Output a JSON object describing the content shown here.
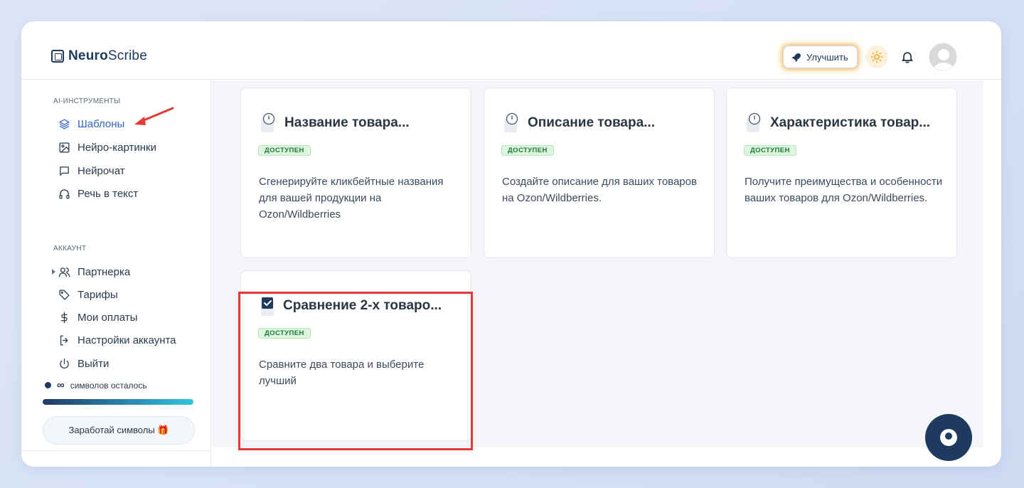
{
  "header": {
    "logo_bold": "Neuro",
    "logo_regular": "Scribe",
    "upgrade_label": "Улучшить"
  },
  "sidebar": {
    "tools_title": "AI-ИНСТРУМЕНТЫ",
    "tools": [
      {
        "label": "Шаблоны",
        "icon": "layers-icon",
        "active": true
      },
      {
        "label": "Нейро-картинки",
        "icon": "image-icon"
      },
      {
        "label": "Нейрочат",
        "icon": "chat-icon"
      },
      {
        "label": "Речь в текст",
        "icon": "headphones-icon"
      }
    ],
    "account_title": "АККАУНТ",
    "account": [
      {
        "label": "Партнерка",
        "icon": "users-icon"
      },
      {
        "label": "Тарифы",
        "icon": "tag-icon"
      },
      {
        "label": "Мои оплаты",
        "icon": "dollar-icon"
      },
      {
        "label": "Настройки аккаунта",
        "icon": "logout-arrow-icon"
      },
      {
        "label": "Выйти",
        "icon": "power-icon"
      }
    ],
    "credits_symbol": "∞",
    "credits_label": "символов осталось",
    "earn_label": "Заработай символы 🎁"
  },
  "cards": [
    {
      "title": "Название товара...",
      "badge": "ДОСТУПЕН",
      "desc": "Сгенерируйте кликбейтные названия для вашей продукции на Ozon/Wildberries",
      "icon": "clipboard-clock-icon"
    },
    {
      "title": "Описание товара...",
      "badge": "ДОСТУПЕН",
      "desc": "Создайте описание для ваших товаров на Ozon/Wildberries.",
      "icon": "clipboard-clock-icon"
    },
    {
      "title": "Характеристика товар...",
      "badge": "ДОСТУПЕН",
      "desc": "Получите преимущества и особенности ваших товаров для Ozon/Wildberries.",
      "icon": "clipboard-clock-icon"
    },
    {
      "title": "Сравнение 2-х товаро...",
      "badge": "ДОСТУПЕН",
      "desc": "Сравните два товара и выберите лучший",
      "icon": "checkbox-icon"
    }
  ],
  "colors": {
    "accent": "#2e63c7",
    "brand_dark": "#1e3a5f",
    "badge_green": "#1c7a3a",
    "highlight_red": "#e53935"
  }
}
